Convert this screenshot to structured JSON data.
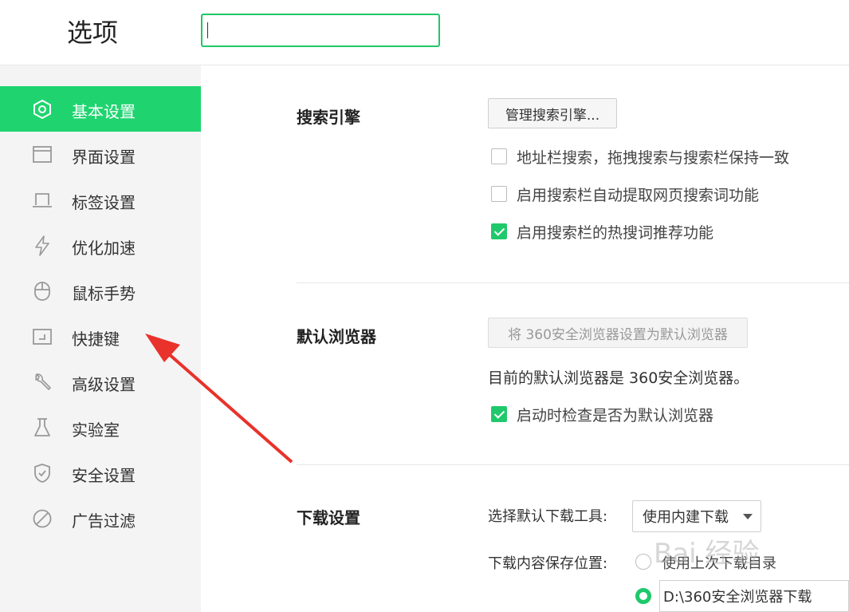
{
  "header": {
    "title": "选项",
    "search_value": ""
  },
  "sidebar": {
    "items": [
      {
        "label": "基本设置",
        "icon": "settings-hexagon-icon",
        "active": true
      },
      {
        "label": "界面设置",
        "icon": "window-icon",
        "active": false
      },
      {
        "label": "标签设置",
        "icon": "tab-icon",
        "active": false
      },
      {
        "label": "优化加速",
        "icon": "lightning-icon",
        "active": false
      },
      {
        "label": "鼠标手势",
        "icon": "mouse-icon",
        "active": false
      },
      {
        "label": "快捷键",
        "icon": "shortcut-icon",
        "active": false
      },
      {
        "label": "高级设置",
        "icon": "wrench-icon",
        "active": false
      },
      {
        "label": "实验室",
        "icon": "flask-icon",
        "active": false
      },
      {
        "label": "安全设置",
        "icon": "shield-icon",
        "active": false
      },
      {
        "label": "广告过滤",
        "icon": "block-icon",
        "active": false
      }
    ]
  },
  "search_engine": {
    "title": "搜索引擎",
    "manage_button": "管理搜索引擎...",
    "options": [
      {
        "label": "地址栏搜索，拖拽搜索与搜索栏保持一致",
        "checked": false
      },
      {
        "label": "启用搜索栏自动提取网页搜索词功能",
        "checked": false
      },
      {
        "label": "启用搜索栏的热搜词推荐功能",
        "checked": true
      }
    ]
  },
  "default_browser": {
    "title": "默认浏览器",
    "set_default_button": "将 360安全浏览器设置为默认浏览器",
    "status_text": "目前的默认浏览器是 360安全浏览器。",
    "check_on_start": {
      "label": "启动时检查是否为默认浏览器",
      "checked": true
    }
  },
  "download": {
    "title": "下载设置",
    "tool_label": "选择默认下载工具:",
    "tool_value": "使用内建下载",
    "save_location_label": "下载内容保存位置:",
    "option_last_dir": "使用上次下载目录",
    "path_value": "D:\\360安全浏览器下载"
  },
  "overlay": {
    "watermark": "Bai 经验",
    "arrow_color": "#e8322b"
  },
  "colors": {
    "accent": "#1fd46f",
    "checkbox_green": "#1fc96b"
  }
}
